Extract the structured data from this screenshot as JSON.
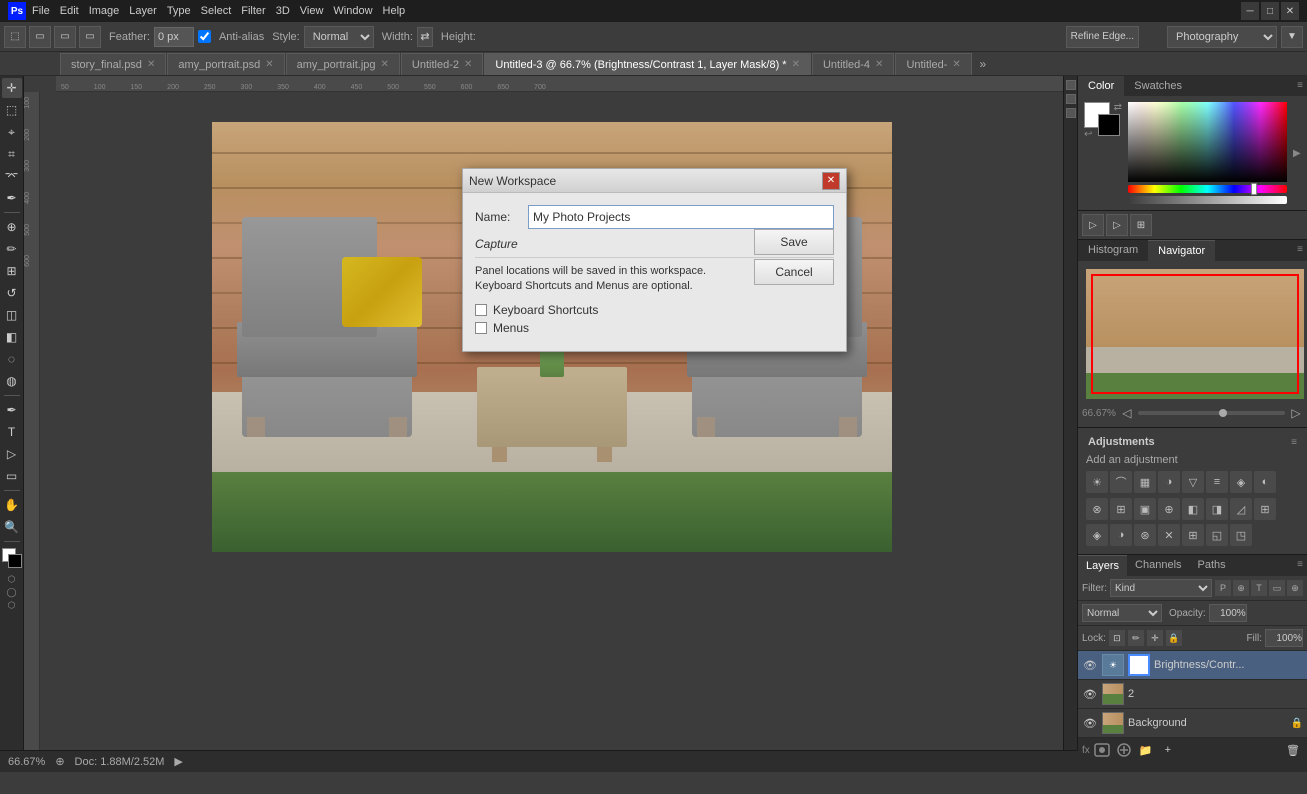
{
  "titlebar": {
    "app_name": "Adobe Photoshop",
    "min_btn": "─",
    "max_btn": "□",
    "close_btn": "✕"
  },
  "menubar": {
    "items": [
      "File",
      "Edit",
      "Image",
      "Layer",
      "Type",
      "Select",
      "Filter",
      "3D",
      "View",
      "Window",
      "Help"
    ]
  },
  "toolbar": {
    "feather_label": "Feather:",
    "feather_value": "0 px",
    "anti_alias": "Anti-alias",
    "style_label": "Style:",
    "style_value": "Normal",
    "width_label": "Width:",
    "height_label": "Height:",
    "refine_edge": "Refine Edge...",
    "workspace": "Photography"
  },
  "tabs": [
    {
      "label": "story_final.psd",
      "active": false
    },
    {
      "label": "amy_portrait.psd",
      "active": false
    },
    {
      "label": "amy_portrait.jpg",
      "active": false
    },
    {
      "label": "Untitled-2",
      "active": false
    },
    {
      "label": "Untitled-3 @ 66.7% (Brightness/Contrast 1, Layer Mask/8) *",
      "active": true
    },
    {
      "label": "Untitled-4",
      "active": false
    },
    {
      "label": "Untitled-",
      "active": false
    }
  ],
  "left_tools": [
    "⬚",
    "▭",
    "⌖",
    "✂",
    "⌫",
    "✏",
    "⬡",
    "✂",
    "⬡",
    "✒",
    "◻",
    "☐",
    "⊕",
    "⊖",
    "☁",
    "∷",
    "🖊",
    "T",
    "⬡",
    "☐",
    "🔍",
    "✋",
    "⬡"
  ],
  "canvas": {
    "zoom": "66.67%",
    "doc_size": "Doc: 1.88M/2.52M"
  },
  "panels": {
    "color_tab": "Color",
    "swatches_tab": "Swatches",
    "histogram_tab": "Histogram",
    "navigator_tab": "Navigator",
    "adjustments_title": "Adjustments",
    "adjustments_subtitle": "Add an adjustment",
    "layers_tab": "Layers",
    "channels_tab": "Channels",
    "paths_tab": "Paths"
  },
  "layers": {
    "blend_mode": "Normal",
    "opacity_label": "Opacity:",
    "opacity_value": "100%",
    "lock_label": "Lock:",
    "fill_label": "Fill:",
    "fill_value": "100%",
    "items": [
      {
        "name": "Brightness/Contr...",
        "visible": true,
        "selected": true,
        "has_mask": true,
        "has_thumb": true
      },
      {
        "name": "2",
        "visible": true,
        "selected": false,
        "has_mask": false,
        "has_thumb": true
      },
      {
        "name": "Background",
        "visible": true,
        "selected": false,
        "has_mask": false,
        "has_thumb": true,
        "locked": true
      }
    ],
    "kind_label": "Kind",
    "filter_label": "Filter:"
  },
  "modal": {
    "title": "New Workspace",
    "name_label": "Name:",
    "name_value": "My Photo Projects",
    "capture_label": "Capture",
    "description": "Panel locations will be saved in this workspace.\nKeyboard Shortcuts and Menus are optional.",
    "keyboard_shortcuts": "Keyboard Shortcuts",
    "menus": "Menus",
    "save_btn": "Save",
    "cancel_btn": "Cancel",
    "close_btn": "✕"
  },
  "navigator": {
    "zoom_value": "66.67%"
  }
}
